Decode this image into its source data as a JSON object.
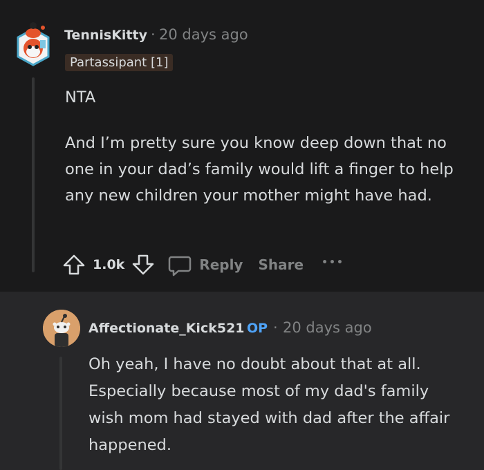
{
  "comment": {
    "author": "TennisKitty",
    "separator": "·",
    "time": "20 days ago",
    "flair": "Partassipant [1]",
    "paragraphs": [
      "NTA",
      "And I’m pretty sure you know deep down that no one in your dad’s family would lift a finger to help any new children your mother might have had."
    ],
    "votes": "1.0k",
    "reply_label": "Reply",
    "share_label": "Share",
    "more_label": "•••"
  },
  "reply": {
    "author": "Affectionate_Kick521",
    "op_badge": "OP",
    "separator": "·",
    "time": "20 days ago",
    "text": "Oh yeah, I have no doubt about that at all. Especially because most of my dad's family wish mom had stayed with dad after the affair happened."
  },
  "colors": {
    "background": "#1a1a1b",
    "reply_background": "#272729",
    "text": "#d7dadc",
    "muted": "#818384",
    "op_blue": "#4fa3f7",
    "flair_bg": "#3a2c24"
  },
  "icons": {
    "upvote": "upvote-arrow-icon",
    "downvote": "downvote-arrow-icon",
    "reply": "speech-bubble-icon",
    "more": "more-dots-icon",
    "top_avatar": "snoo-avatar-icon",
    "reply_avatar": "snoo-avatar-icon"
  }
}
